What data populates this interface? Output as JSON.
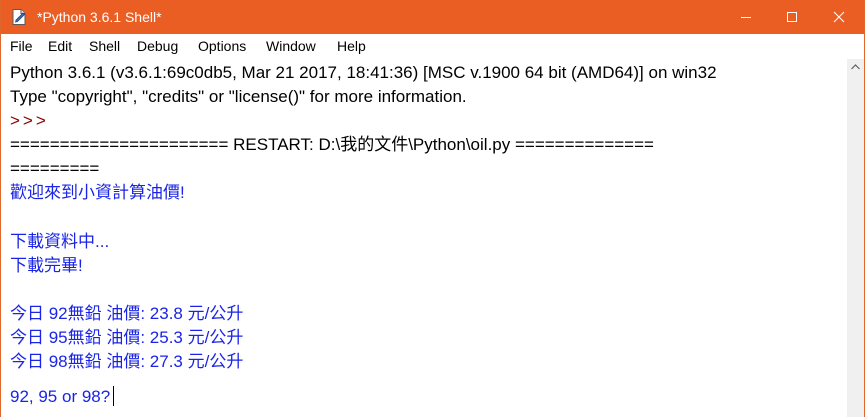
{
  "window": {
    "title": "*Python 3.6.1 Shell*"
  },
  "menu": [
    "File",
    "Edit",
    "Shell",
    "Debug",
    "Options",
    "Window",
    "Help"
  ],
  "shell": {
    "banner_line1": "Python 3.6.1 (v3.6.1:69c0db5, Mar 21 2017, 18:41:36) [MSC v.1900 64 bit (AMD64)] on win32",
    "banner_line2": "Type \"copyright\", \"credits\" or \"license()\" for more information.",
    "prompt": ">>>",
    "restart_line1": "====================== RESTART: D:\\我的文件\\Python\\oil.py ==============",
    "restart_line2": "=========",
    "welcome": "歡迎來到小資計算油價!",
    "downloading": "下載資料中...",
    "download_done": "下載完畢!",
    "price_92": "今日 92無鉛 油價:  23.8  元/公升",
    "price_95": "今日 95無鉛 油價:  25.3  元/公升",
    "price_98": "今日 98無鉛 油價:  27.3  元/公升",
    "input_prompt": "92, 95 or 98?"
  },
  "colors": {
    "titlebar": "#ea5e24",
    "stdout": "#1a24e6",
    "prompt": "#8b0000",
    "console_text": "#000000"
  },
  "icons": {
    "app": "python-idle-icon",
    "minimize": "minimize-icon",
    "maximize": "maximize-icon",
    "close": "close-icon",
    "scroll_up": "chevron-up-icon"
  }
}
